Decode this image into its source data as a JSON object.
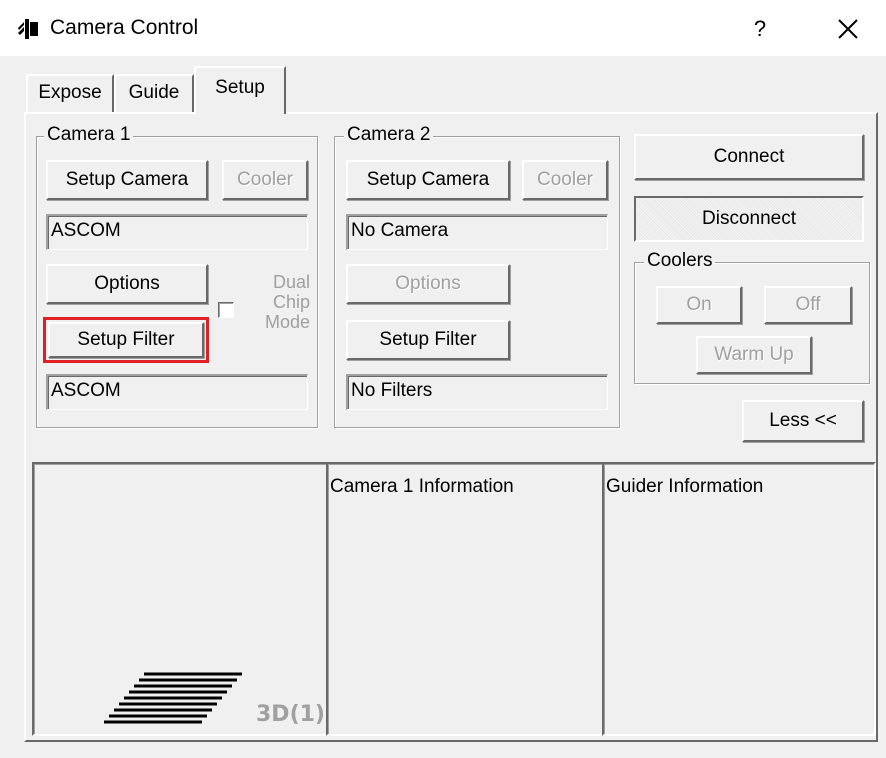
{
  "window": {
    "title": "Camera Control",
    "help_glyph": "?",
    "close_glyph": "✕",
    "app_icon": "camera-control-app-icon"
  },
  "tabs": [
    {
      "label": "Expose",
      "selected": false
    },
    {
      "label": "Guide",
      "selected": false
    },
    {
      "label": "Setup",
      "selected": true
    }
  ],
  "camera1": {
    "group_label": "Camera 1",
    "setup_camera_label": "Setup Camera",
    "cooler_label": "Cooler",
    "camera_value": "ASCOM",
    "options_label": "Options",
    "setup_filter_label": "Setup Filter",
    "filter_value": "ASCOM",
    "dual_chip_label_line1": "Dual",
    "dual_chip_label_line2": "Chip",
    "dual_chip_label_line3": "Mode"
  },
  "camera2": {
    "group_label": "Camera 2",
    "setup_camera_label": "Setup Camera",
    "cooler_label": "Cooler",
    "camera_value": "No Camera",
    "options_label": "Options",
    "setup_filter_label": "Setup Filter",
    "filter_value": "No Filters"
  },
  "connection": {
    "connect_label": "Connect",
    "disconnect_label": "Disconnect"
  },
  "coolers": {
    "group_label": "Coolers",
    "on_label": "On",
    "off_label": "Off",
    "warm_up_label": "Warm Up"
  },
  "less_label": "Less <<",
  "info": {
    "logo_text": "3D(1)",
    "camera1_info_title": "Camera 1 Information",
    "guider_info_title": "Guider Information"
  },
  "colors": {
    "highlight": "#e02020",
    "face": "#f0f0f0",
    "disabled_text": "#a0a0a0"
  }
}
